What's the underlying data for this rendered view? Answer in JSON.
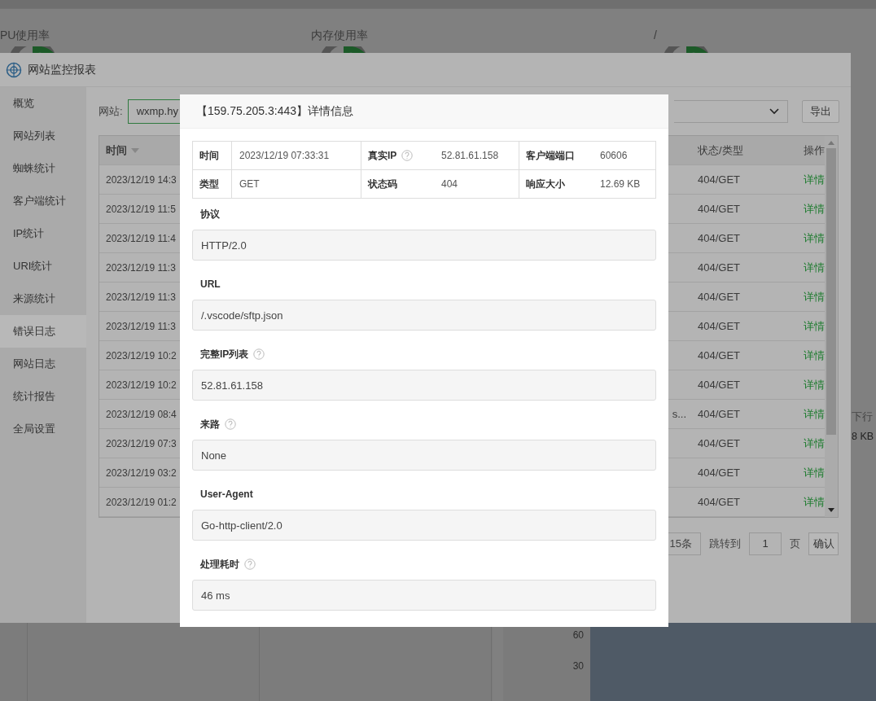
{
  "background": {
    "gauges": [
      {
        "label": "PU使用率"
      },
      {
        "label": "内存使用率"
      },
      {
        "label": "/"
      }
    ],
    "traffic": {
      "label": "下行",
      "value": "8 KB"
    },
    "chart_ticks": [
      "60",
      "30"
    ]
  },
  "window": {
    "title": "网站监控报表"
  },
  "sidebar": {
    "items": [
      {
        "label": "概览",
        "selected": false
      },
      {
        "label": "网站列表",
        "selected": false
      },
      {
        "label": "蜘蛛统计",
        "selected": false
      },
      {
        "label": "客户端统计",
        "selected": false
      },
      {
        "label": "IP统计",
        "selected": false
      },
      {
        "label": "URI统计",
        "selected": false
      },
      {
        "label": "来源统计",
        "selected": false
      },
      {
        "label": "错误日志",
        "selected": true
      },
      {
        "label": "网站日志",
        "selected": false
      },
      {
        "label": "统计报告",
        "selected": false
      },
      {
        "label": "全局设置",
        "selected": false
      }
    ]
  },
  "toolbar": {
    "site_label": "网站:",
    "site_value": "wxmp.hy",
    "export_button": "导出"
  },
  "table": {
    "columns": [
      "时间",
      "状态/类型",
      "操作"
    ],
    "rows": [
      {
        "time": "2023/12/19 14:3",
        "status": "404/GET",
        "action": "详情"
      },
      {
        "time": "2023/12/19 11:5",
        "status": "404/GET",
        "action": "详情"
      },
      {
        "time": "2023/12/19 11:4",
        "status": "404/GET",
        "action": "详情"
      },
      {
        "time": "2023/12/19 11:3",
        "status": "404/GET",
        "action": "详情"
      },
      {
        "time": "2023/12/19 11:3",
        "status": "404/GET",
        "action": "详情"
      },
      {
        "time": "2023/12/19 11:3",
        "status": "404/GET",
        "action": "详情"
      },
      {
        "time": "2023/12/19 10:2",
        "status": "404/GET",
        "action": "详情"
      },
      {
        "time": "2023/12/19 10:2",
        "status": "404/GET",
        "action": "详情"
      },
      {
        "time": "2023/12/19 08:4",
        "column_3": "s...",
        "status": "404/GET",
        "action": "详情"
      },
      {
        "time": "2023/12/19 07:3",
        "status": "404/GET",
        "action": "详情"
      },
      {
        "time": "2023/12/19 03:2",
        "status": "404/GET",
        "action": "详情"
      },
      {
        "time": "2023/12/19 01:2",
        "status": "404/GET",
        "action": "详情"
      }
    ]
  },
  "pagination": {
    "total": "15条",
    "jump_label": "跳转到",
    "page": "1",
    "page_unit": "页",
    "confirm": "确认"
  },
  "dialog": {
    "title": "【159.75.205.3:443】详情信息",
    "info": [
      [
        {
          "label": "时间",
          "value": "2023/12/19 07:33:31",
          "help": false
        },
        {
          "label": "真实IP",
          "value": "52.81.61.158",
          "help": true
        },
        {
          "label": "客户端端口",
          "value": "60606",
          "help": false
        }
      ],
      [
        {
          "label": "类型",
          "value": "GET",
          "help": false
        },
        {
          "label": "状态码",
          "value": "404",
          "help": false
        },
        {
          "label": "响应大小",
          "value": "12.69 KB",
          "help": false
        }
      ]
    ],
    "sections": [
      {
        "label": "协议",
        "help": false,
        "value": "HTTP/2.0"
      },
      {
        "label": "URL",
        "help": false,
        "value": "/.vscode/sftp.json"
      },
      {
        "label": "完整IP列表",
        "help": true,
        "value": "52.81.61.158"
      },
      {
        "label": "来路",
        "help": true,
        "value": "None"
      },
      {
        "label": "User-Agent",
        "help": false,
        "value": "Go-http-client/2.0"
      },
      {
        "label": "处理耗时",
        "help": true,
        "value": "46 ms"
      }
    ]
  }
}
